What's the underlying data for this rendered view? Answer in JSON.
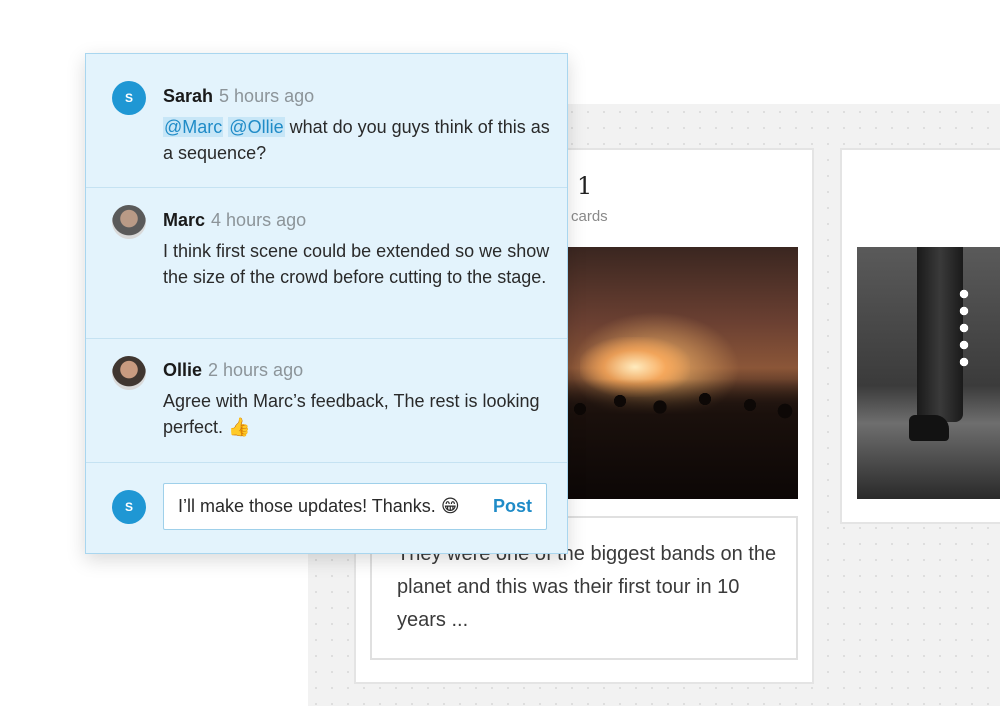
{
  "storyboard": {
    "card_number": "1",
    "card_count_label": "cards",
    "caption": "They were one of the biggest bands on the planet and this was their first tour in 10 years ..."
  },
  "comments": [
    {
      "author": "Sarah",
      "time": "5 hours ago",
      "avatar_letter": "S",
      "mentions": [
        "@Marc",
        "@Ollie"
      ],
      "text": "what do you guys think of this as a sequence?"
    },
    {
      "author": "Marc",
      "time": "4 hours ago",
      "text": "I think first scene could be extended so we show the size of the crowd before cutting to the stage."
    },
    {
      "author": "Ollie",
      "time": "2 hours ago",
      "text": "Agree with Marc’s feedback, The rest is looking perfect.",
      "emoji": "👍"
    }
  ],
  "reply": {
    "avatar_letter": "S",
    "value": "I’ll make those updates! Thanks.",
    "emoji": "😁",
    "post_label": "Post"
  },
  "colors": {
    "accent": "#1f97d4",
    "popover_bg": "#e3f3fc",
    "mention_bg": "#c7e6f7"
  }
}
